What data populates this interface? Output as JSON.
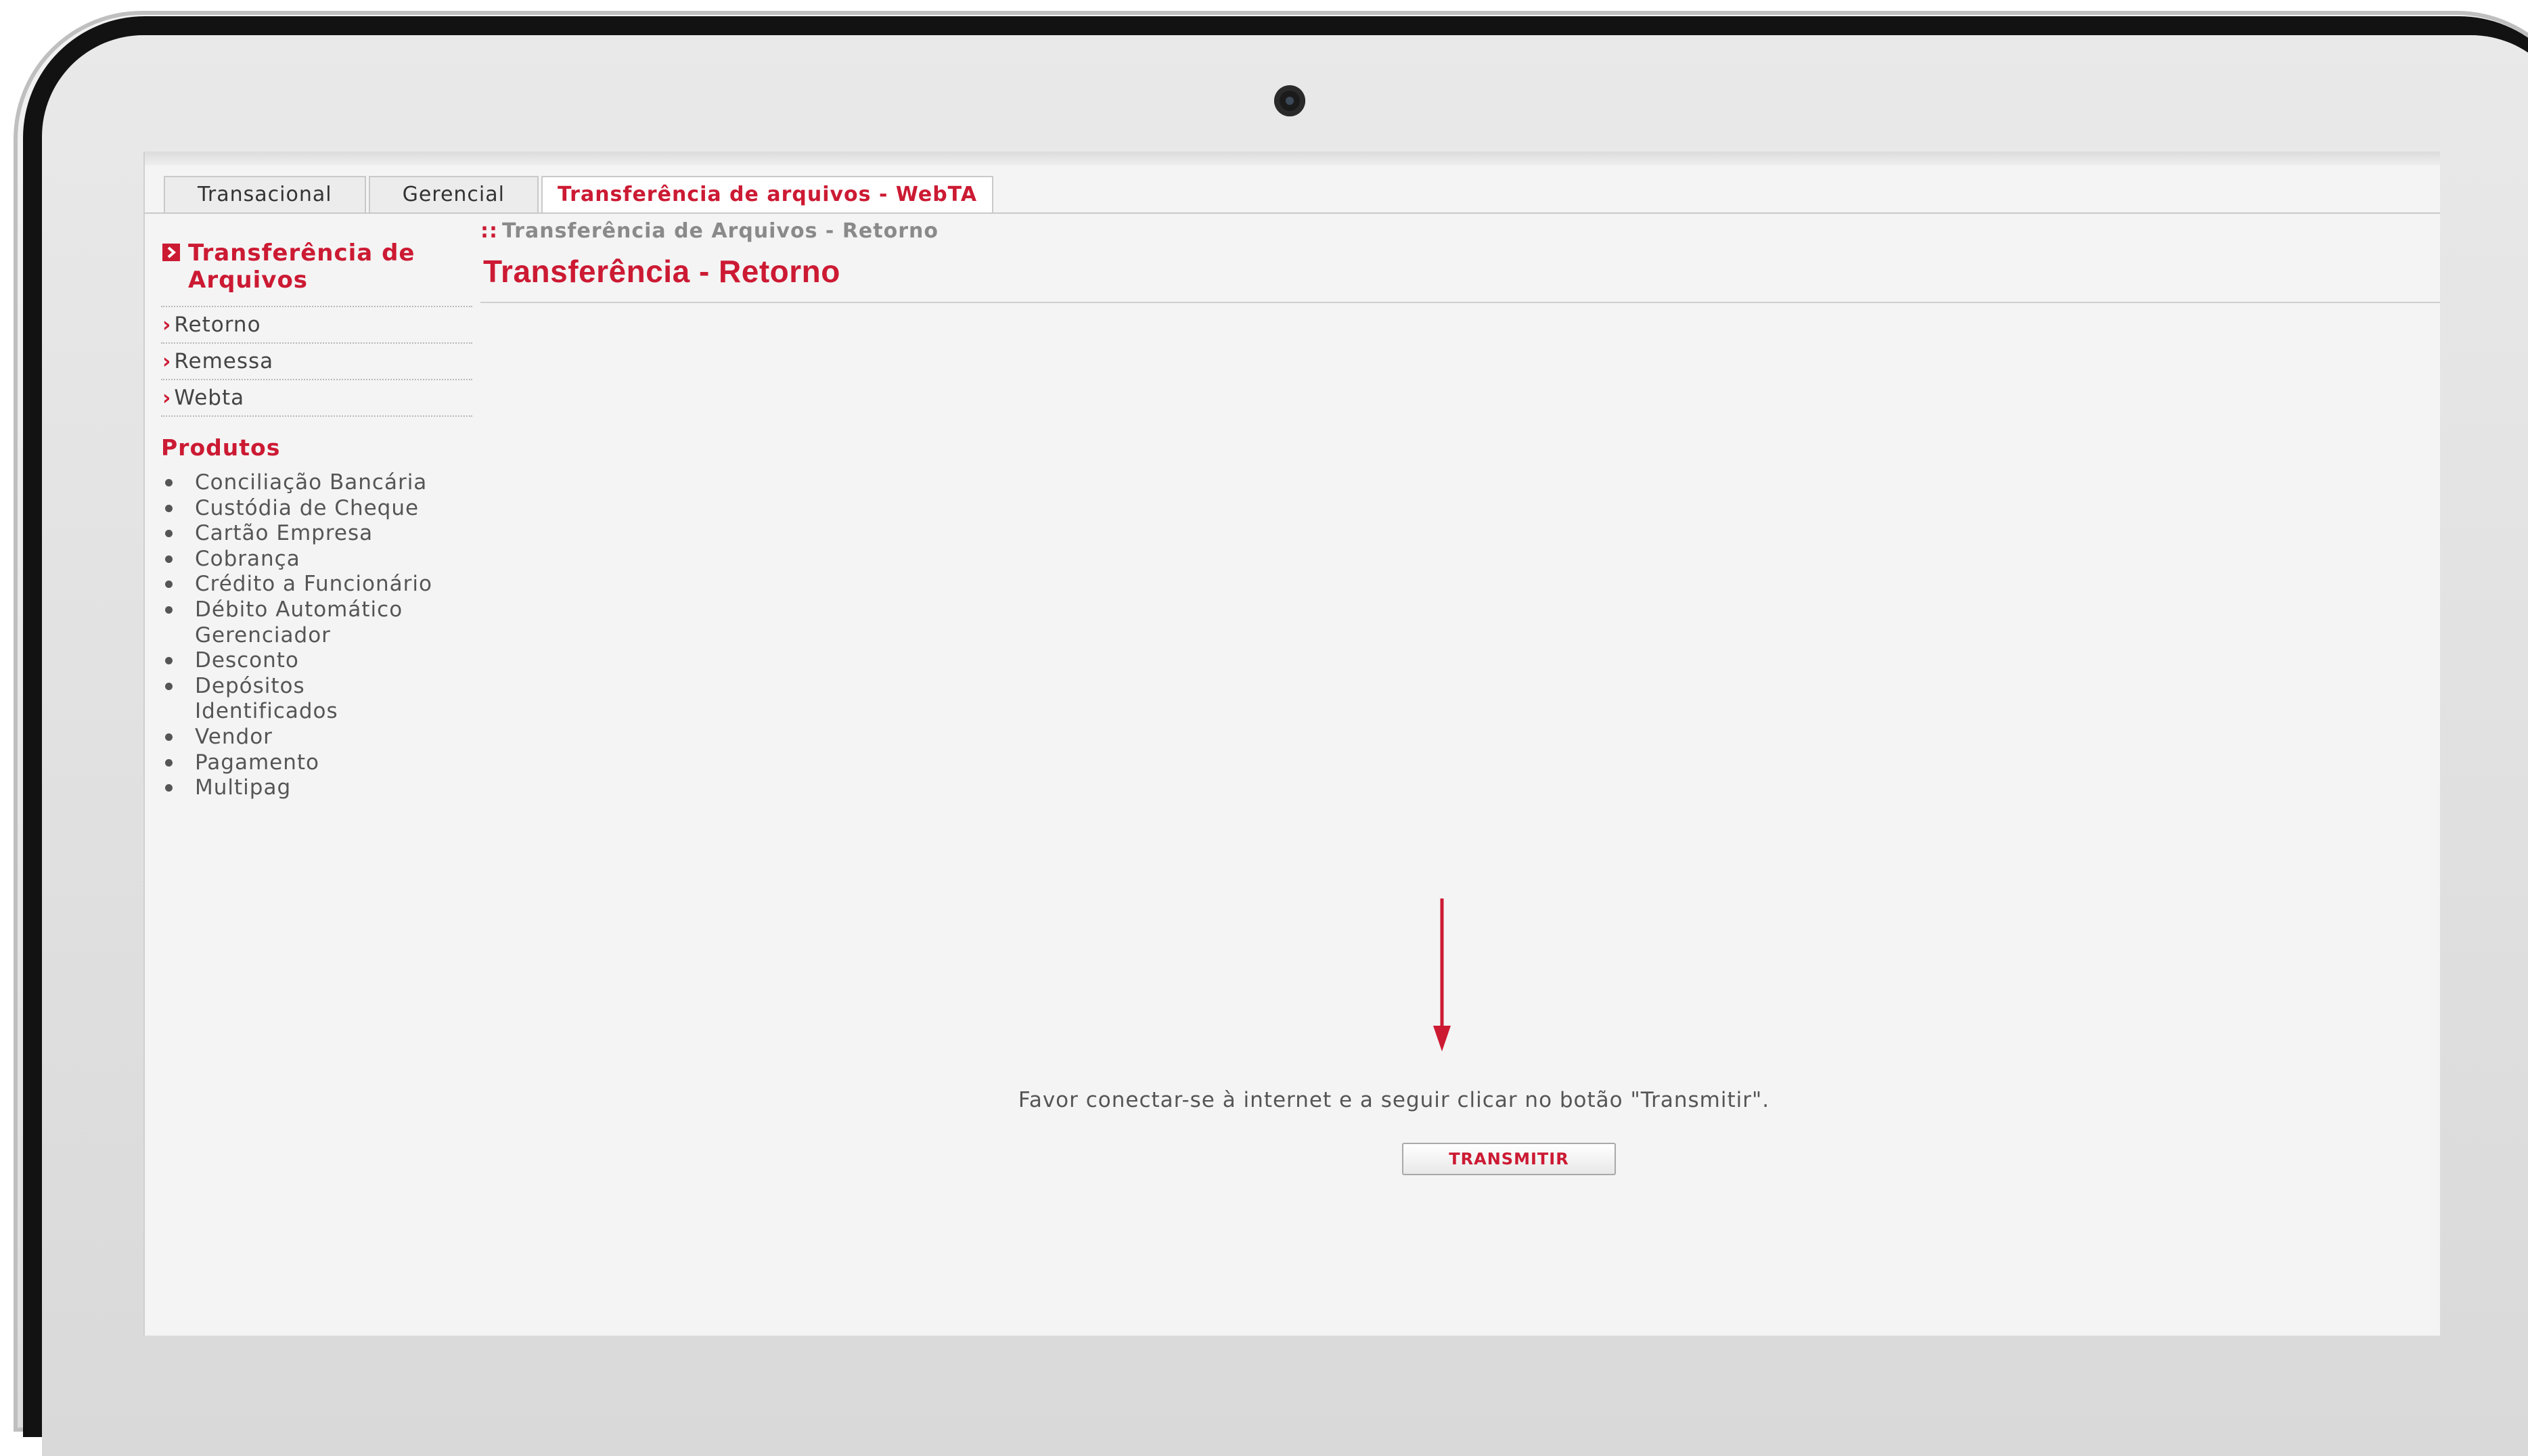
{
  "tabs": [
    {
      "label": "Transacional"
    },
    {
      "label": "Gerencial"
    },
    {
      "label": "Transferência de arquivos - WebTA"
    }
  ],
  "sidebar": {
    "title": "Transferência de Arquivos",
    "links": [
      {
        "label": "Retorno"
      },
      {
        "label": "Remessa"
      },
      {
        "label": "Webta"
      }
    ],
    "produtos_title": "Produtos",
    "produtos": [
      "Conciliação Bancária",
      "Custódia de Cheque",
      "Cartão Empresa",
      "Cobrança",
      "Crédito a Funcionário",
      "Débito Automático Gerenciador",
      "Desconto",
      "Depósitos Identificados",
      "Vendor",
      "Pagamento",
      "Multipag"
    ]
  },
  "breadcrumb": {
    "mark": "::",
    "text": "Transferência de Arquivos - Retorno"
  },
  "page_title": "Transferência - Retorno",
  "message": "Favor conectar-se à internet e a seguir clicar no botão \"Transmitir\".",
  "transmit_button": "TRANSMITIR",
  "colors": {
    "accent": "#cc1a33",
    "text": "#555555",
    "background": "#f4f4f4"
  },
  "icons": {
    "sidebar_title": "square-chevron-icon",
    "link": "chevron-right-icon",
    "annotation": "down-arrow-icon"
  }
}
